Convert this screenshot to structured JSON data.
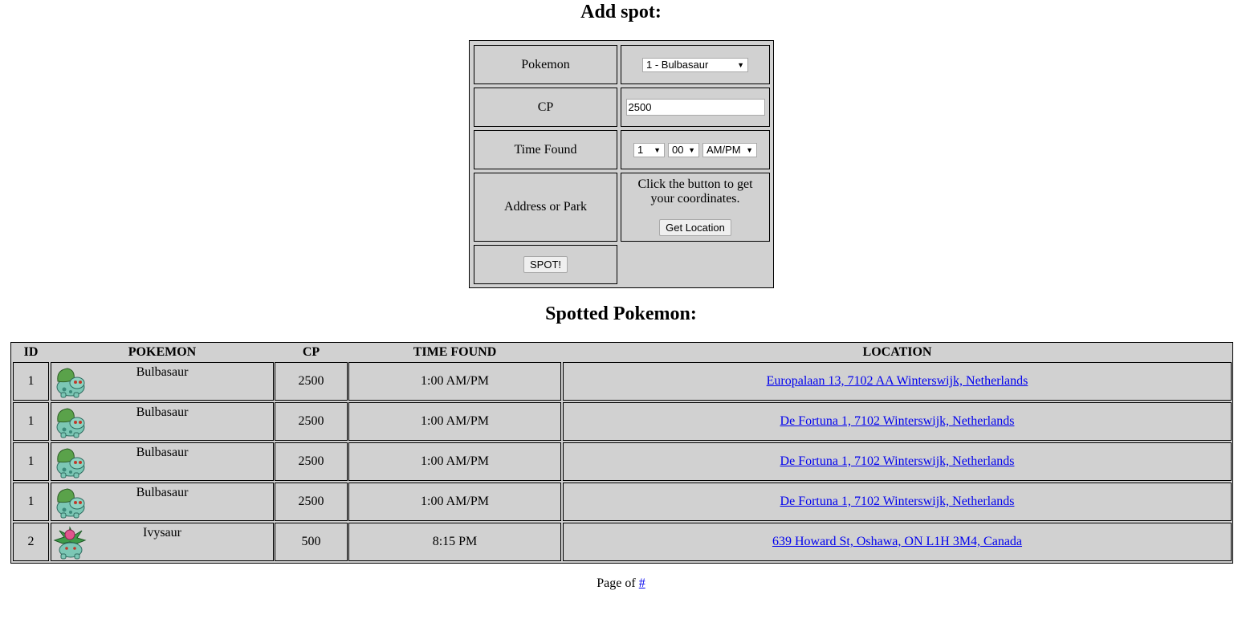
{
  "add_spot": {
    "title": "Add spot:",
    "pokemon_label": "Pokemon",
    "pokemon_selected": "1 - Bulbasaur",
    "cp_label": "CP",
    "cp_value": "2500",
    "time_label": "Time Found",
    "time_hour": "1",
    "time_minute": "00",
    "time_ampm": "AM/PM",
    "address_label": "Address or Park",
    "address_message": "Click the button to get your coordinates.",
    "get_location_label": "Get Location",
    "spot_label": "SPOT!"
  },
  "spotted": {
    "title": "Spotted Pokemon:",
    "headers": [
      "ID",
      "POKEMON",
      "CP",
      "TIME FOUND",
      "LOCATION"
    ],
    "rows": [
      {
        "id": "1",
        "pokemon": "Bulbasaur",
        "icon": "bulbasaur-icon",
        "cp": "2500",
        "time": "1:00 AM/PM",
        "location": "Europalaan 13, 7102 AA Winterswijk, Netherlands"
      },
      {
        "id": "1",
        "pokemon": "Bulbasaur",
        "icon": "bulbasaur-icon",
        "cp": "2500",
        "time": "1:00 AM/PM",
        "location": "De Fortuna 1, 7102 Winterswijk, Netherlands"
      },
      {
        "id": "1",
        "pokemon": "Bulbasaur",
        "icon": "bulbasaur-icon",
        "cp": "2500",
        "time": "1:00 AM/PM",
        "location": "De Fortuna 1, 7102 Winterswijk, Netherlands"
      },
      {
        "id": "1",
        "pokemon": "Bulbasaur",
        "icon": "bulbasaur-icon",
        "cp": "2500",
        "time": "1:00 AM/PM",
        "location": "De Fortuna 1, 7102 Winterswijk, Netherlands"
      },
      {
        "id": "2",
        "pokemon": "Ivysaur",
        "icon": "ivysaur-icon",
        "cp": "500",
        "time": "8:15 PM",
        "location": "639 Howard St, Oshawa, ON L1H 3M4, Canada"
      }
    ]
  },
  "pager": {
    "prefix": "Page of",
    "link": "#"
  },
  "colors": {
    "table_bg": "#d1d1d1",
    "link": "#0000ee"
  }
}
